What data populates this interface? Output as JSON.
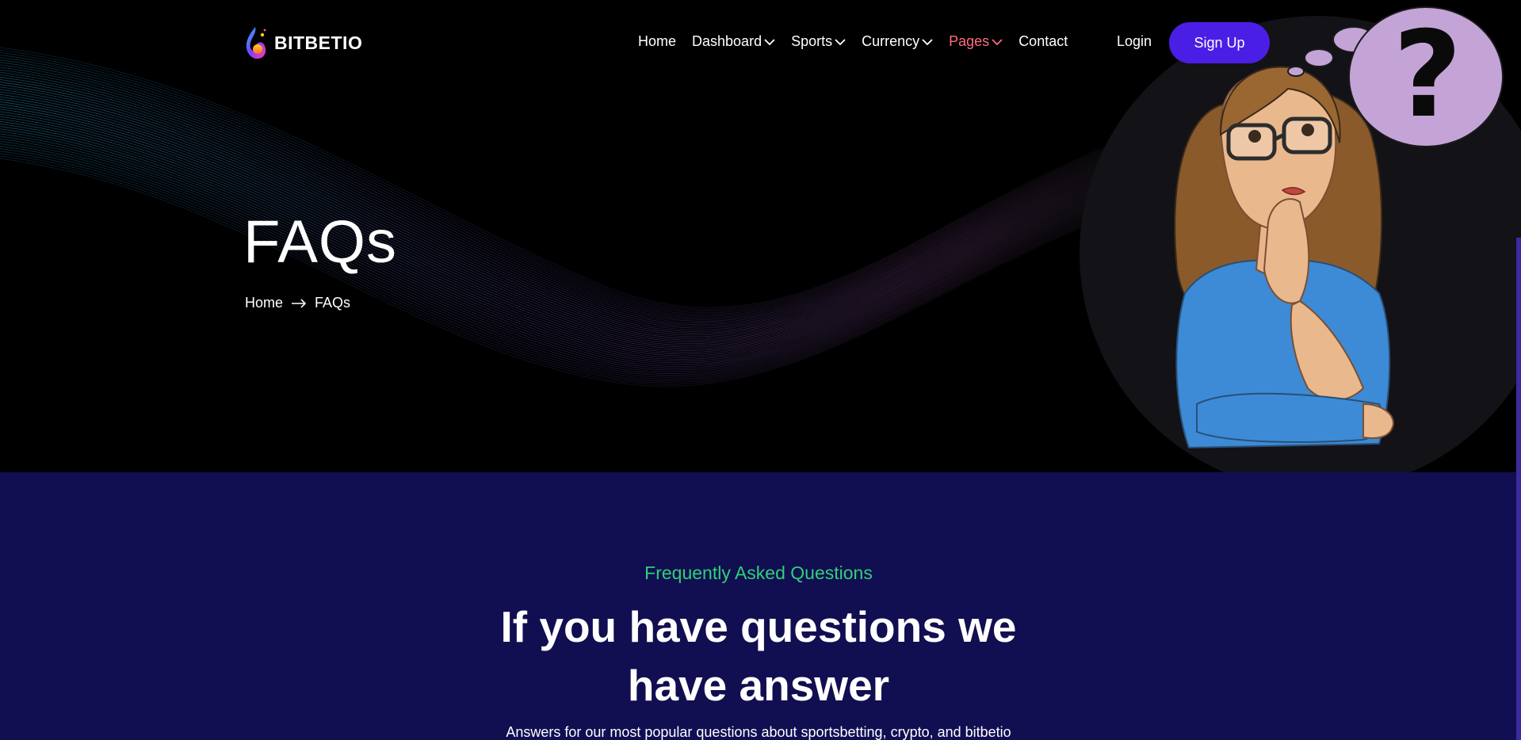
{
  "brand": {
    "name": "BITBETIO"
  },
  "nav": {
    "items": [
      {
        "label": "Home",
        "dropdown": false,
        "active": false
      },
      {
        "label": "Dashboard",
        "dropdown": true,
        "active": false
      },
      {
        "label": "Sports",
        "dropdown": true,
        "active": false
      },
      {
        "label": "Currency",
        "dropdown": true,
        "active": false
      },
      {
        "label": "Pages",
        "dropdown": true,
        "active": true
      },
      {
        "label": "Contact",
        "dropdown": false,
        "active": false
      }
    ],
    "login_label": "Login",
    "signup_label": "Sign Up"
  },
  "hero": {
    "title": "FAQs",
    "breadcrumb": {
      "home": "Home",
      "current": "FAQs"
    }
  },
  "illustration": {
    "bubble_text": "?"
  },
  "faq": {
    "eyebrow": "Frequently Asked Questions",
    "heading_line1": "If you have questions we",
    "heading_line2": "have answer",
    "subtitle": "Answers for our most popular questions about sportsbetting, crypto, and bitbetio"
  },
  "colors": {
    "accent_button": "#4b1ee6",
    "nav_active": "#ff6b81",
    "eyebrow": "#2fd177",
    "faq_background": "#110e51",
    "hero_background": "#000000",
    "bubble": "#c4a4d6"
  }
}
